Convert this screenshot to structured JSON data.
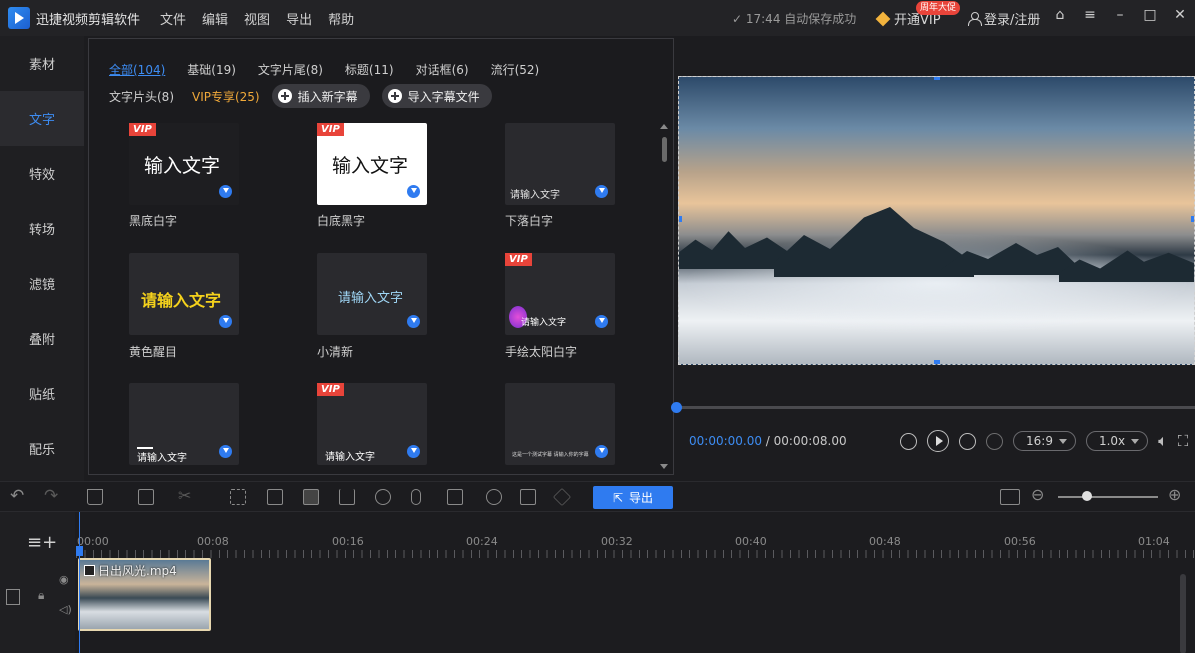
{
  "app": {
    "title": "迅捷视频剪辑软件"
  },
  "menu": [
    "文件",
    "编辑",
    "视图",
    "导出",
    "帮助"
  ],
  "status": {
    "autosave": "✓ 17:44 自动保存成功"
  },
  "header": {
    "vip": "开通VIP",
    "promo": "周年大促",
    "login": "登录/注册"
  },
  "nav": [
    "素材",
    "文字",
    "特效",
    "转场",
    "滤镜",
    "叠附",
    "贴纸",
    "配乐"
  ],
  "categories_row1": [
    "全部(104)",
    "基础(19)",
    "文字片尾(8)",
    "标题(11)",
    "对话框(6)",
    "流行(52)"
  ],
  "categories_row2": [
    "文字片头(8)",
    "VIP专享(25)"
  ],
  "buttons": {
    "insert": "插入新字幕",
    "import": "导入字幕文件"
  },
  "vip_tag": "VIP",
  "cards": [
    {
      "label": "黑底白字",
      "text": "输入文字"
    },
    {
      "label": "白底黑字",
      "text": "输入文字"
    },
    {
      "label": "下落白字",
      "text": "请输入文字"
    },
    {
      "label": "黄色醒目",
      "text": "请输入文字"
    },
    {
      "label": "小清新",
      "text": "请输入文字"
    },
    {
      "label": "手绘太阳白字",
      "text": "请输入文字"
    },
    {
      "label": "",
      "text": "请输入文字"
    },
    {
      "label": "",
      "text": "请输入文字"
    },
    {
      "label": "",
      "text": "这是一个测试字幕 请输入你的字幕"
    }
  ],
  "player": {
    "current": "00:00:00.00",
    "total": " / 00:00:08.00",
    "ratio": "16:9",
    "speed": "1.0x"
  },
  "toolbar": {
    "export": "导出"
  },
  "ruler": [
    "00:00",
    "00:08",
    "00:16",
    "00:24",
    "00:32",
    "00:40",
    "00:48",
    "00:56",
    "01:04"
  ],
  "clip": {
    "name": "日出风光.mp4"
  },
  "colors": {
    "accent": "#2f7bf0",
    "vip": "#f0a93a",
    "badge": "#e8443a"
  }
}
